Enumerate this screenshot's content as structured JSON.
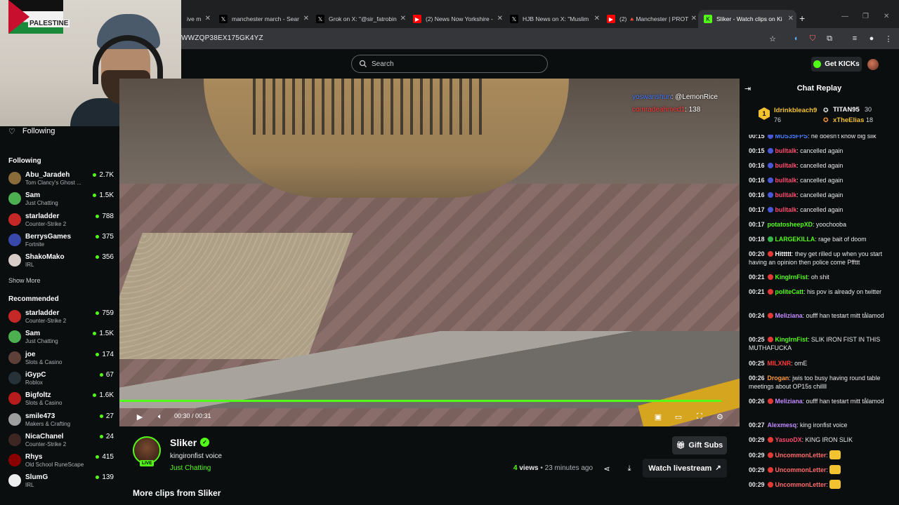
{
  "browser": {
    "tabs": [
      {
        "title": "ive m",
        "favicon": "partial"
      },
      {
        "title": "manchester march - Sear",
        "favicon": "x-icon"
      },
      {
        "title": "Grok on X: \"@sir_fatrobin",
        "favicon": "x-icon"
      },
      {
        "title": "(2) News Now Yorkshire -",
        "favicon": "youtube-icon"
      },
      {
        "title": "HJB News on X: \"Muslim",
        "favicon": "x-icon"
      },
      {
        "title": "(2) 🔺Manchester | PROT",
        "favicon": "youtube-icon"
      },
      {
        "title": "Sliker - Watch clips on Ki",
        "favicon": "kick-icon"
      }
    ],
    "new_tab": "+",
    "url": "WWZQP38EX175GK4YZ"
  },
  "header": {
    "search_placeholder": "Search",
    "get_kicks": "Get KICKs"
  },
  "webcam": {
    "flag_label": "PALESTINE"
  },
  "sidebar": {
    "following_label": "Following",
    "following_section": "Following",
    "following": [
      {
        "name": "Abu_Jaradeh",
        "category": "Tom Clancy's Ghost ...",
        "viewers": "2.7K",
        "color": "#8a6b3a"
      },
      {
        "name": "Sam",
        "category": "Just Chatting",
        "viewers": "1.5K",
        "color": "#4caf50"
      },
      {
        "name": "starladder",
        "category": "Counter-Strike 2",
        "viewers": "788",
        "color": "#c62828"
      },
      {
        "name": "BerrysGames",
        "category": "Fortnite",
        "viewers": "375",
        "color": "#3949ab"
      },
      {
        "name": "ShakoMako",
        "category": "IRL",
        "viewers": "356",
        "color": "#d7ccc8"
      }
    ],
    "show_more": "Show More",
    "recommended_section": "Recommended",
    "recommended": [
      {
        "name": "starladder",
        "category": "Counter-Strike 2",
        "viewers": "759",
        "color": "#c62828"
      },
      {
        "name": "Sam",
        "category": "Just Chatting",
        "viewers": "1.5K",
        "color": "#4caf50"
      },
      {
        "name": "joe",
        "category": "Slots & Casino",
        "viewers": "174",
        "color": "#5d4037"
      },
      {
        "name": "iGypC",
        "category": "Roblox",
        "viewers": "67",
        "color": "#263238"
      },
      {
        "name": "Bigfoltz",
        "category": "Slots & Casino",
        "viewers": "1.6K",
        "color": "#b71c1c"
      },
      {
        "name": "smile473",
        "category": "Makers & Crafting",
        "viewers": "27",
        "color": "#9e9e9e"
      },
      {
        "name": "NicaChanel",
        "category": "Counter-Strike 2",
        "viewers": "24",
        "color": "#3e2723"
      },
      {
        "name": "Rhys",
        "category": "Old School RuneScape",
        "viewers": "415",
        "color": "#8b0000"
      },
      {
        "name": "SlumG",
        "category": "IRL",
        "viewers": "139",
        "color": "#eeeeee"
      }
    ]
  },
  "video": {
    "overlay_lines": [
      {
        "user": "yoswanshun",
        "text": ": @LemonRice"
      },
      {
        "user": "comradeahmed1",
        "text": ": 138"
      }
    ],
    "time": "00:30 / 00:31",
    "progress": 0.97
  },
  "clip": {
    "streamer": "Sliker",
    "live_badge": "LIVE",
    "title": "kingironfist voice",
    "category": "Just Chatting",
    "views_count": "4",
    "views_word": "views",
    "age": "23 minutes ago",
    "gift_subs": "Gift Subs",
    "watch_livestream": "Watch livestream",
    "more_clips": "More clips from Sliker"
  },
  "chat": {
    "title": "Chat Replay",
    "leaderboard": {
      "rank": "1",
      "top_name": "ldrinkbleach9",
      "top_count": "76",
      "second_name": "TITAN95",
      "second_count": "30",
      "third_name": "xTheElias",
      "third_count": "18"
    },
    "messages": [
      {
        "ts": "00:15",
        "user": "MUS35FPS",
        "text": ": he doesn't know big slik",
        "color": "#4a7cff",
        "badge": "#4a56d8"
      },
      {
        "ts": "00:15",
        "user": "bulltalk",
        "text": ": cancelled again",
        "color": "#ff4b6e",
        "badge": "#4a56d8"
      },
      {
        "ts": "00:16",
        "user": "bulltalk",
        "text": ": cancelled again",
        "color": "#ff4b6e",
        "badge": "#4a56d8"
      },
      {
        "ts": "00:16",
        "user": "bulltalk",
        "text": ": cancelled again",
        "color": "#ff4b6e",
        "badge": "#4a56d8"
      },
      {
        "ts": "00:16",
        "user": "bulltalk",
        "text": ": cancelled again",
        "color": "#ff4b6e",
        "badge": "#4a56d8"
      },
      {
        "ts": "00:17",
        "user": "bulltalk",
        "text": ": cancelled again",
        "color": "#ff4b6e",
        "badge": "#4a56d8"
      },
      {
        "ts": "00:17",
        "user": "potatosheepXD",
        "text": ": yoochooba",
        "color": "#53fc18",
        "badge": ""
      },
      {
        "ts": "00:18",
        "user": "LARGEKILLA",
        "text": ": rage bait of doom",
        "color": "#53fc18",
        "badge": "#33b54a"
      },
      {
        "ts": "00:20",
        "user": "Hittttt",
        "text": ": they get rilled up when you start having an opinion then police come Pffttt",
        "color": "#ffffff",
        "badge": "#e53935"
      },
      {
        "ts": "00:21",
        "user": "KingIrnFist",
        "text": ": oh shit",
        "color": "#53fc18",
        "badge": "#e53935"
      },
      {
        "ts": "00:21",
        "user": "politeCatt",
        "text": ": his pov is already on twitter",
        "color": "#53fc18",
        "badge": "#e53935"
      },
      {
        "ts": "00:24",
        "user": "Meliziana",
        "text": ": oufff han testart mitt tålamod",
        "color": "#c38bff",
        "badge": "#e53935"
      },
      {
        "ts": "00:25",
        "user": "KingIrnFist",
        "text": ": SLIK IRON FIST IN THIS MUTHAFUCKA",
        "color": "#53fc18",
        "badge": "#e53935"
      },
      {
        "ts": "00:25",
        "user": "MILXNR",
        "text": ": omE",
        "color": "#ff3b3b",
        "badge": ""
      },
      {
        "ts": "00:26",
        "user": "Drogan",
        "text": ": jwis too busy having round table meetings about OP15s chillll",
        "color": "#ff9a3c",
        "badge": ""
      },
      {
        "ts": "00:26",
        "user": "Meliziana",
        "text": ": oufff han testart mitt tålamod",
        "color": "#c38bff",
        "badge": "#e53935"
      },
      {
        "ts": "00:27",
        "user": "Alexmesq",
        "text": ": king ironfist voice",
        "color": "#c38bff",
        "badge": ""
      },
      {
        "ts": "00:29",
        "user": "YasuoDX",
        "text": ": KING IRON SLIK",
        "color": "#ff4b6e",
        "badge": "#e53935"
      },
      {
        "ts": "00:29",
        "user": "UncommonLetter",
        "text": ":",
        "color": "#ff6b6b",
        "badge": "#e53935"
      },
      {
        "ts": "00:29",
        "user": "UncommonLetter",
        "text": ":",
        "color": "#ff6b6b",
        "badge": "#e53935"
      },
      {
        "ts": "00:29",
        "user": "UncommonLetter",
        "text": ":",
        "color": "#ff6b6b",
        "badge": "#e53935"
      }
    ]
  }
}
